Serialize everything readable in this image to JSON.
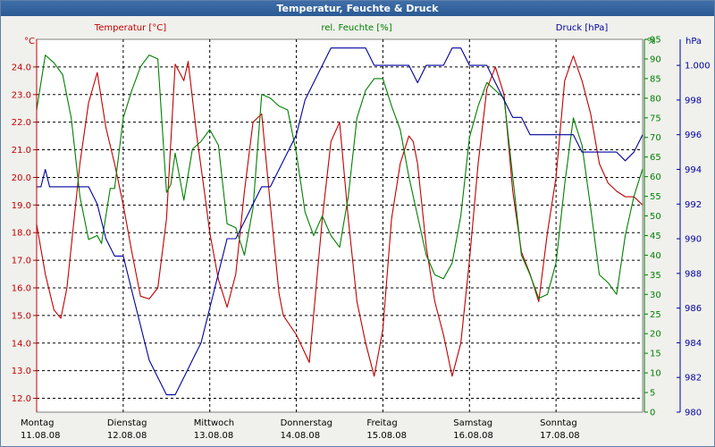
{
  "window": {
    "title": "Temperatur, Feuchte & Druck"
  },
  "colors": {
    "temp": "#c00000",
    "hum": "#008000",
    "press": "#0000a0",
    "grid": "#000000",
    "plot_bg": "#ffffff"
  },
  "chart_data": {
    "type": "line",
    "title": "Temperatur, Feuchte & Druck",
    "x_range": [
      0,
      7
    ],
    "x_ticks": [
      {
        "day": "Montag",
        "date": "11.08.08"
      },
      {
        "day": "Dienstag",
        "date": "12.08.08"
      },
      {
        "day": "Mittwoch",
        "date": "13.08.08"
      },
      {
        "day": "Donnerstag",
        "date": "14.08.08"
      },
      {
        "day": "Freitag",
        "date": "15.08.08"
      },
      {
        "day": "Samstag",
        "date": "16.08.08"
      },
      {
        "day": "Sonntag",
        "date": "17.08.08"
      }
    ],
    "grid": true,
    "axes": {
      "temp": {
        "label": "Temperatur [°C]",
        "unit": "°C",
        "range": [
          11.5,
          25
        ],
        "ticks": [
          "12.0",
          "13.0",
          "14.0",
          "15.0",
          "16.0",
          "17.0",
          "18.0",
          "19.0",
          "20.0",
          "21.0",
          "22.0",
          "23.0",
          "24.0"
        ]
      },
      "hum": {
        "label": "rel. Feuchte [%]",
        "unit": "%",
        "range": [
          0,
          95
        ],
        "ticks": [
          "0",
          "5",
          "10",
          "15",
          "20",
          "25",
          "30",
          "35",
          "40",
          "45",
          "50",
          "55",
          "60",
          "65",
          "70",
          "75",
          "80",
          "85",
          "90",
          "95"
        ]
      },
      "press": {
        "label": "Druck [hPa]",
        "unit": "hPa",
        "range": [
          980,
          1001.5
        ],
        "ticks": [
          "980",
          "982",
          "984",
          "986",
          "988",
          "990",
          "992",
          "994",
          "996",
          "998",
          "1.000"
        ]
      }
    },
    "series": [
      {
        "name": "Temperatur [°C]",
        "axis": "temp",
        "x": [
          0,
          0.1,
          0.2,
          0.28,
          0.35,
          0.5,
          0.6,
          0.7,
          0.8,
          0.9,
          1.0,
          1.1,
          1.2,
          1.3,
          1.4,
          1.5,
          1.6,
          1.7,
          1.75,
          1.85,
          1.95,
          2.0,
          2.1,
          2.2,
          2.3,
          2.4,
          2.5,
          2.6,
          2.7,
          2.8,
          2.85,
          3.0,
          3.15,
          3.3,
          3.4,
          3.5,
          3.6,
          3.7,
          3.8,
          3.9,
          4.0,
          4.1,
          4.2,
          4.3,
          4.35,
          4.4,
          4.5,
          4.6,
          4.7,
          4.8,
          4.9,
          5.0,
          5.1,
          5.2,
          5.3,
          5.4,
          5.5,
          5.6,
          5.7,
          5.8,
          5.9,
          6.0,
          6.1,
          6.2,
          6.3,
          6.4,
          6.5,
          6.6,
          6.7,
          6.8,
          6.9,
          7.0
        ],
        "values": [
          18.3,
          16.5,
          15.2,
          14.9,
          16.0,
          20.5,
          22.7,
          23.8,
          21.8,
          20.5,
          19.0,
          17.3,
          15.7,
          15.6,
          16.0,
          18.5,
          24.1,
          23.5,
          24.2,
          21.5,
          19.2,
          18.0,
          16.3,
          15.3,
          16.5,
          19.5,
          22.0,
          22.3,
          19.0,
          15.8,
          15.0,
          14.3,
          13.3,
          18.5,
          21.3,
          22.0,
          18.5,
          15.5,
          14.0,
          12.8,
          14.5,
          18.5,
          20.5,
          21.5,
          21.3,
          20.5,
          17.5,
          15.5,
          14.3,
          12.8,
          14.0,
          17.0,
          20.5,
          23.2,
          24.0,
          23.0,
          19.5,
          17.3,
          16.5,
          15.5,
          18.0,
          20.0,
          23.5,
          24.4,
          23.5,
          22.3,
          20.5,
          19.8,
          19.5,
          19.3,
          19.3,
          19.0
        ]
      },
      {
        "name": "rel. Feuchte [%]",
        "axis": "hum",
        "x": [
          0,
          0.1,
          0.2,
          0.3,
          0.4,
          0.5,
          0.6,
          0.7,
          0.75,
          0.85,
          0.9,
          1.0,
          1.1,
          1.2,
          1.3,
          1.4,
          1.5,
          1.55,
          1.6,
          1.7,
          1.8,
          1.9,
          2.0,
          2.1,
          2.2,
          2.3,
          2.4,
          2.5,
          2.6,
          2.7,
          2.8,
          2.9,
          3.0,
          3.1,
          3.2,
          3.3,
          3.4,
          3.5,
          3.6,
          3.7,
          3.8,
          3.9,
          4.0,
          4.1,
          4.2,
          4.3,
          4.4,
          4.5,
          4.6,
          4.7,
          4.8,
          4.9,
          5.0,
          5.1,
          5.2,
          5.3,
          5.4,
          5.5,
          5.6,
          5.7,
          5.8,
          5.9,
          6.0,
          6.1,
          6.2,
          6.3,
          6.4,
          6.5,
          6.6,
          6.7,
          6.8,
          6.9,
          7.0
        ],
        "values": [
          77,
          91,
          89,
          86,
          75,
          55,
          44,
          45,
          43,
          57,
          57,
          75,
          82,
          88,
          91,
          90,
          56,
          58,
          66,
          54,
          67,
          69,
          72,
          68,
          48,
          47,
          40,
          52,
          81,
          80,
          78,
          77,
          66,
          51,
          45,
          50,
          45,
          42,
          55,
          75,
          82,
          85,
          85,
          78,
          72,
          60,
          50,
          40,
          35,
          34,
          38,
          50,
          70,
          78,
          84,
          82,
          80,
          60,
          40,
          35,
          29,
          30,
          38,
          58,
          75,
          68,
          52,
          35,
          33,
          30,
          45,
          55,
          62
        ]
      },
      {
        "name": "Druck [hPa]",
        "axis": "press",
        "x": [
          0,
          0.05,
          0.1,
          0.15,
          0.2,
          0.3,
          0.4,
          0.5,
          0.6,
          0.7,
          0.8,
          0.9,
          1.0,
          1.05,
          1.1,
          1.2,
          1.3,
          1.4,
          1.5,
          1.6,
          1.7,
          1.8,
          1.9,
          2.0,
          2.1,
          2.2,
          2.3,
          2.4,
          2.5,
          2.6,
          2.7,
          2.8,
          2.9,
          3.0,
          3.1,
          3.2,
          3.3,
          3.4,
          3.5,
          3.6,
          3.7,
          3.8,
          3.9,
          4.0,
          4.1,
          4.2,
          4.3,
          4.4,
          4.5,
          4.6,
          4.7,
          4.8,
          4.9,
          5.0,
          5.1,
          5.2,
          5.3,
          5.4,
          5.5,
          5.6,
          5.7,
          5.8,
          5.9,
          6.0,
          6.1,
          6.2,
          6.3,
          6.4,
          6.5,
          6.6,
          6.7,
          6.8,
          6.9,
          7.0
        ],
        "values": [
          993,
          993,
          994,
          993,
          993,
          993,
          993,
          993,
          993,
          992,
          990,
          989,
          989,
          988,
          987,
          985,
          983,
          982,
          981,
          981,
          982,
          983,
          984,
          986,
          988,
          990,
          990,
          991,
          992,
          993,
          993,
          994,
          995,
          996,
          998,
          999,
          1000,
          1001,
          1001,
          1001,
          1001,
          1001,
          1000,
          1000,
          1000,
          1000,
          1000,
          999,
          1000,
          1000,
          1000,
          1001,
          1001,
          1000,
          1000,
          1000,
          999,
          998,
          997,
          997,
          996,
          996,
          996,
          996,
          996,
          996,
          995,
          995,
          995,
          995,
          995,
          994.5,
          995,
          996
        ]
      }
    ]
  }
}
